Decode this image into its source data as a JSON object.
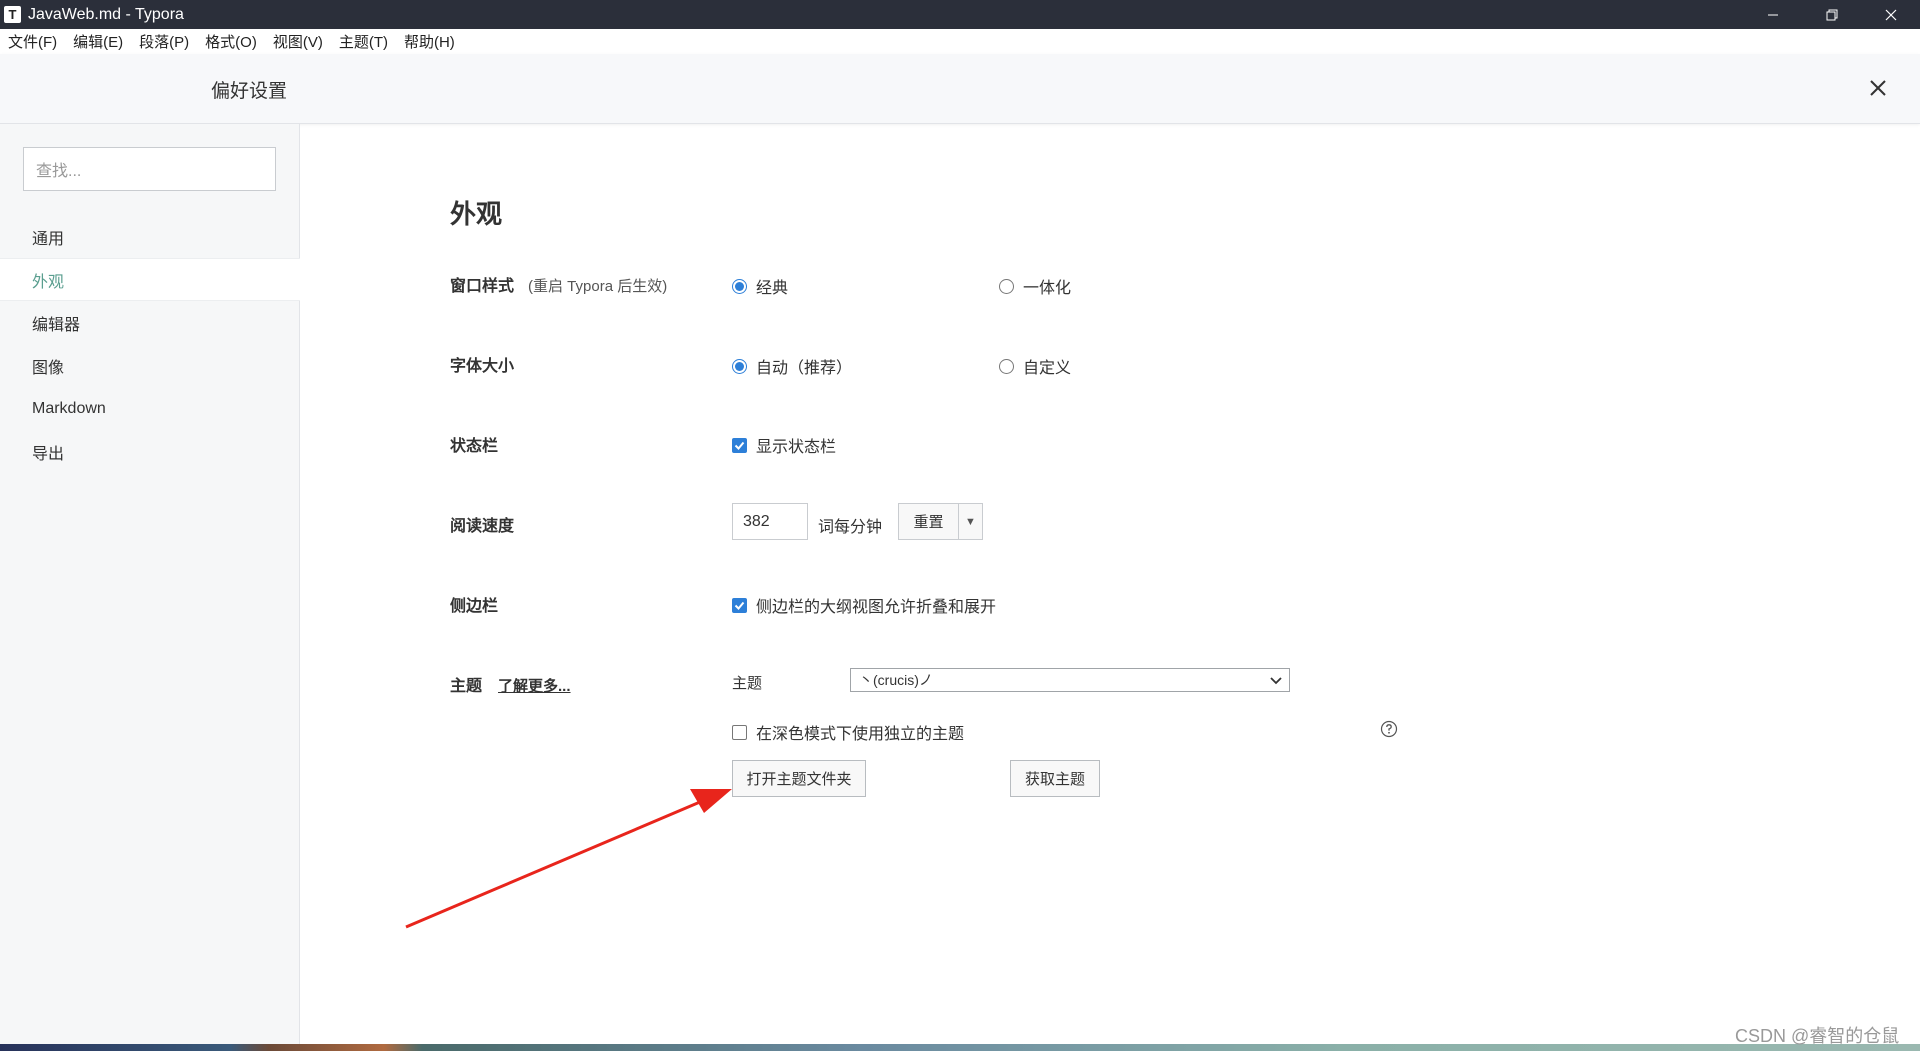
{
  "window": {
    "app_icon": "T",
    "title": "JavaWeb.md - Typora"
  },
  "menu": [
    "文件(F)",
    "编辑(E)",
    "段落(P)",
    "格式(O)",
    "视图(V)",
    "主题(T)",
    "帮助(H)"
  ],
  "prefs": {
    "title": "偏好设置"
  },
  "sidebar": {
    "search_placeholder": "查找...",
    "items": [
      "通用",
      "外观",
      "编辑器",
      "图像",
      "Markdown",
      "导出"
    ],
    "active_index": 1
  },
  "appearance": {
    "title": "外观",
    "window_style": {
      "label": "窗口样式",
      "note": "(重启 Typora 后生效)",
      "options": [
        "经典",
        "一体化"
      ],
      "selected": "经典"
    },
    "font_size": {
      "label": "字体大小",
      "options": [
        "自动（推荐）",
        "自定义"
      ],
      "selected": "自动（推荐）"
    },
    "status_bar": {
      "label": "状态栏",
      "checkbox_label": "显示状态栏",
      "checked": true
    },
    "reading_speed": {
      "label": "阅读速度",
      "value": "382",
      "unit": "词每分钟",
      "reset_label": "重置"
    },
    "sidebar_opt": {
      "label": "侧边栏",
      "checkbox_label": "侧边栏的大纲视图允许折叠和展开",
      "checked": true
    },
    "theme": {
      "label": "主题",
      "learn_more": "了解更多...",
      "select_label": "主题",
      "selected_theme": "丶(crucis)ノ",
      "dark_mode_label": "在深色模式下使用独立的主题",
      "dark_mode_checked": false,
      "open_folder_label": "打开主题文件夹",
      "get_themes_label": "获取主题"
    }
  },
  "watermark": "CSDN @睿智的仓鼠",
  "colors": {
    "titlebar": "#2b2f3a",
    "accent": "#5a9e8f",
    "control_blue": "#2d7fd8",
    "annotation": "#e8251c"
  }
}
